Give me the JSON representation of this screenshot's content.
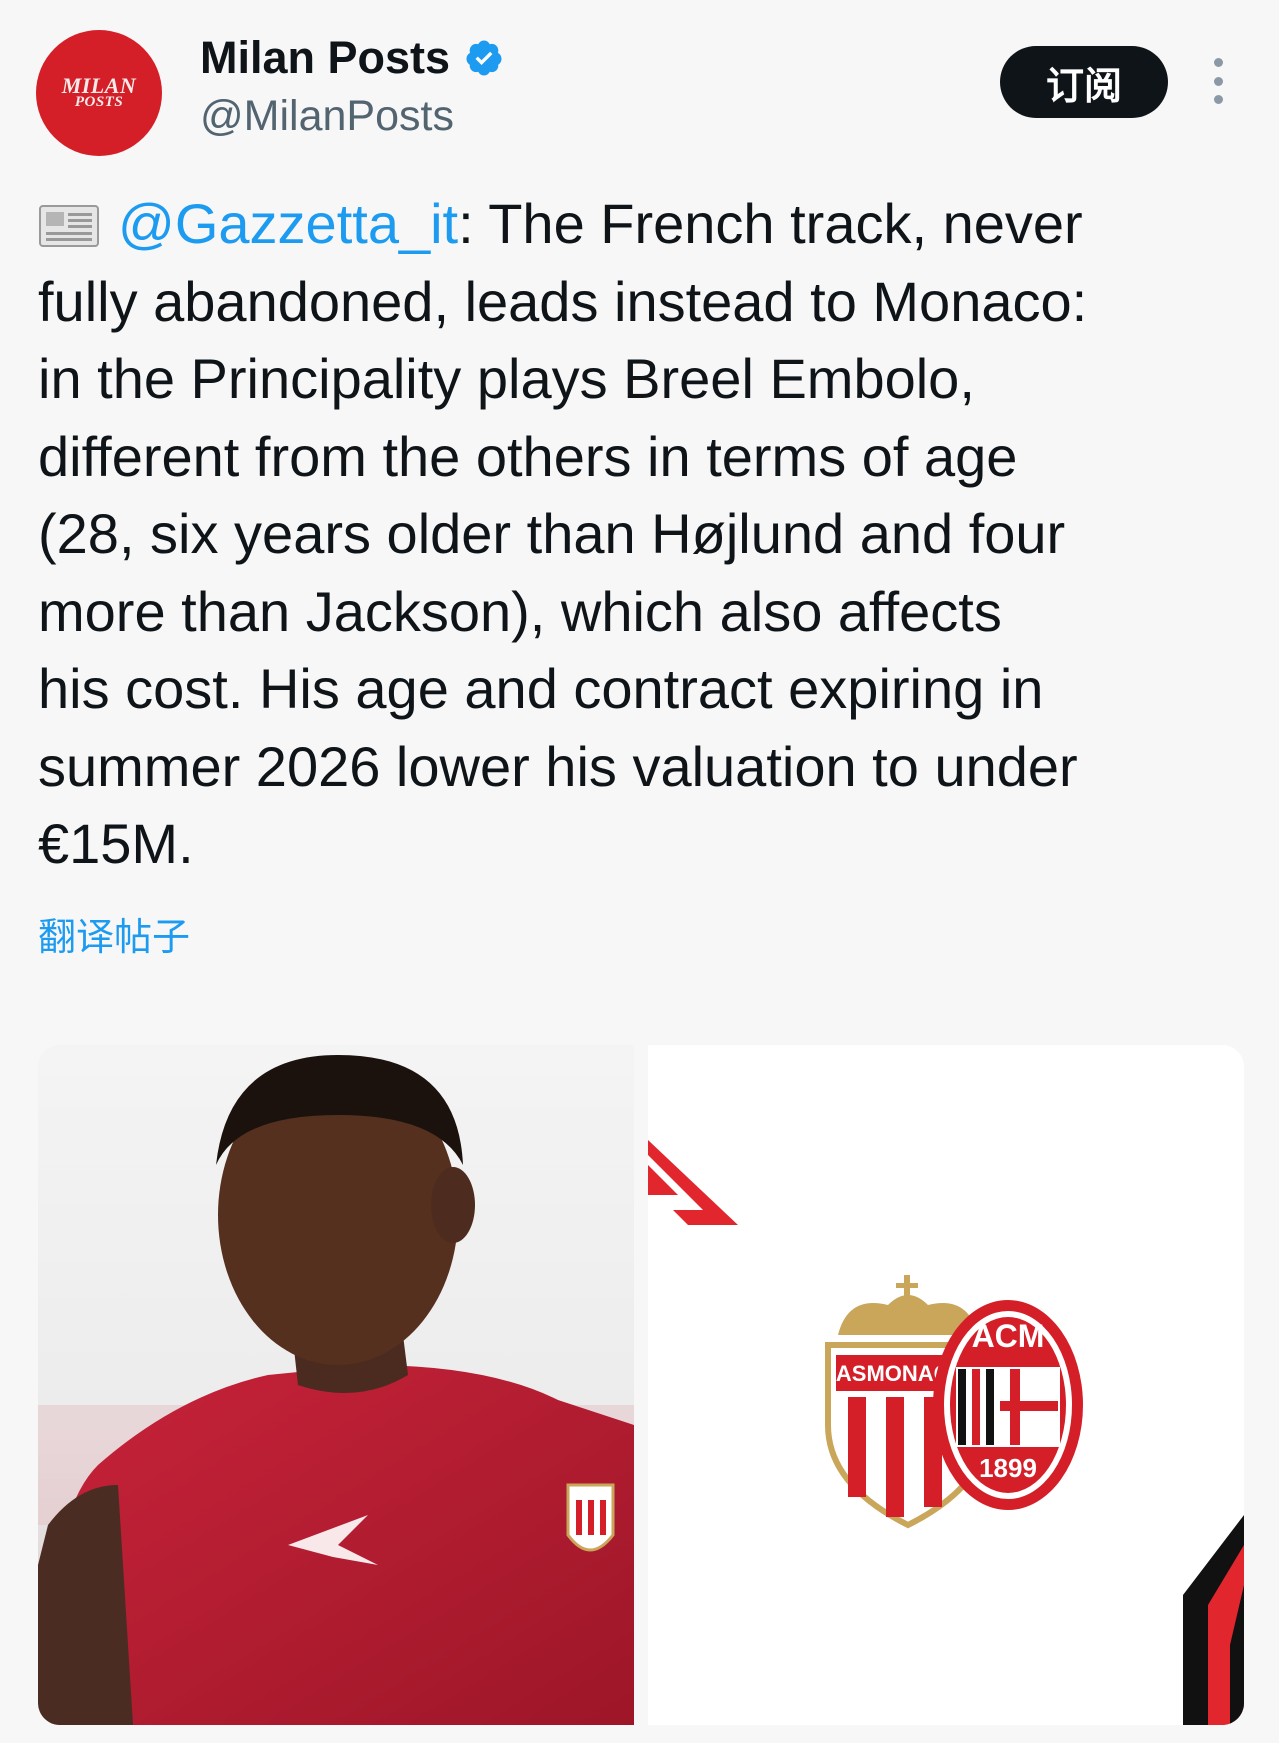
{
  "account": {
    "avatar_line1": "MILAN",
    "avatar_line2": "POSTS",
    "display_name": "Milan Posts",
    "verified_icon": "verified-badge-icon",
    "handle": "@MilanPosts"
  },
  "actions": {
    "subscribe_label": "订阅",
    "more_icon": "more-vertical-icon"
  },
  "tweet": {
    "emoji_icon": "newspaper-icon",
    "mention": "@Gazzetta_it",
    "body": ": The French track, never\nfully abandoned, leads instead to Monaco:\nin the Principality plays Breel Embolo,\ndifferent from the others in terms of age\n(28, six years older than Højlund and four\nmore than Jackson), which also affects\nhis cost. His age and contract expiring in\nsummer 2026 lower his valuation to under\n€15M.",
    "translate_label": "翻译帖子"
  },
  "media": {
    "left_image": "player-photo",
    "right_image": "club-crests-graphic",
    "crest_left_text": "ASMONACOF",
    "crest_right_top": "ACM",
    "crest_right_year": "1899"
  },
  "colors": {
    "accent": "#1d9bf0",
    "milan_red": "#d51f28",
    "text": "#0f1419",
    "secondary": "#536471"
  }
}
